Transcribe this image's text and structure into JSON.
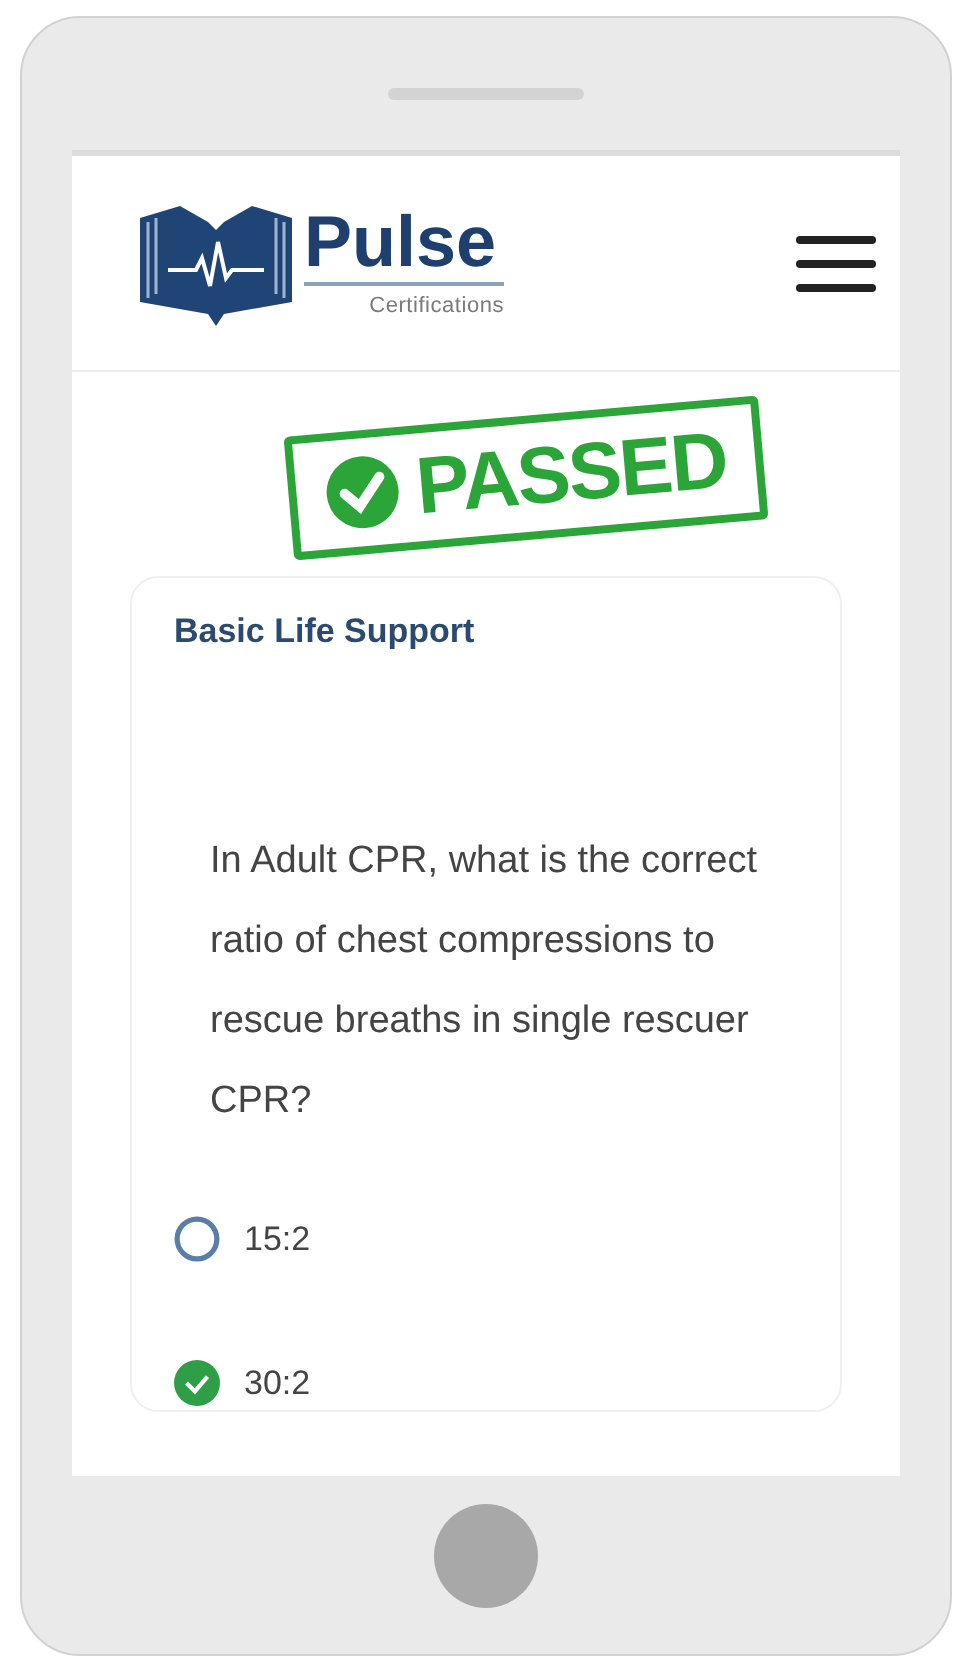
{
  "header": {
    "logo_title": "Pulse",
    "logo_subtitle": "Certifications"
  },
  "stamp": {
    "text": "PASSED"
  },
  "card": {
    "category": "Basic Life Support",
    "question": "In Adult CPR, what is the correct ratio of chest compressions to rescue breaths in single rescuer CPR?",
    "options": [
      {
        "label": "15:2",
        "selected": false
      },
      {
        "label": "30:2",
        "selected": true
      }
    ]
  }
}
